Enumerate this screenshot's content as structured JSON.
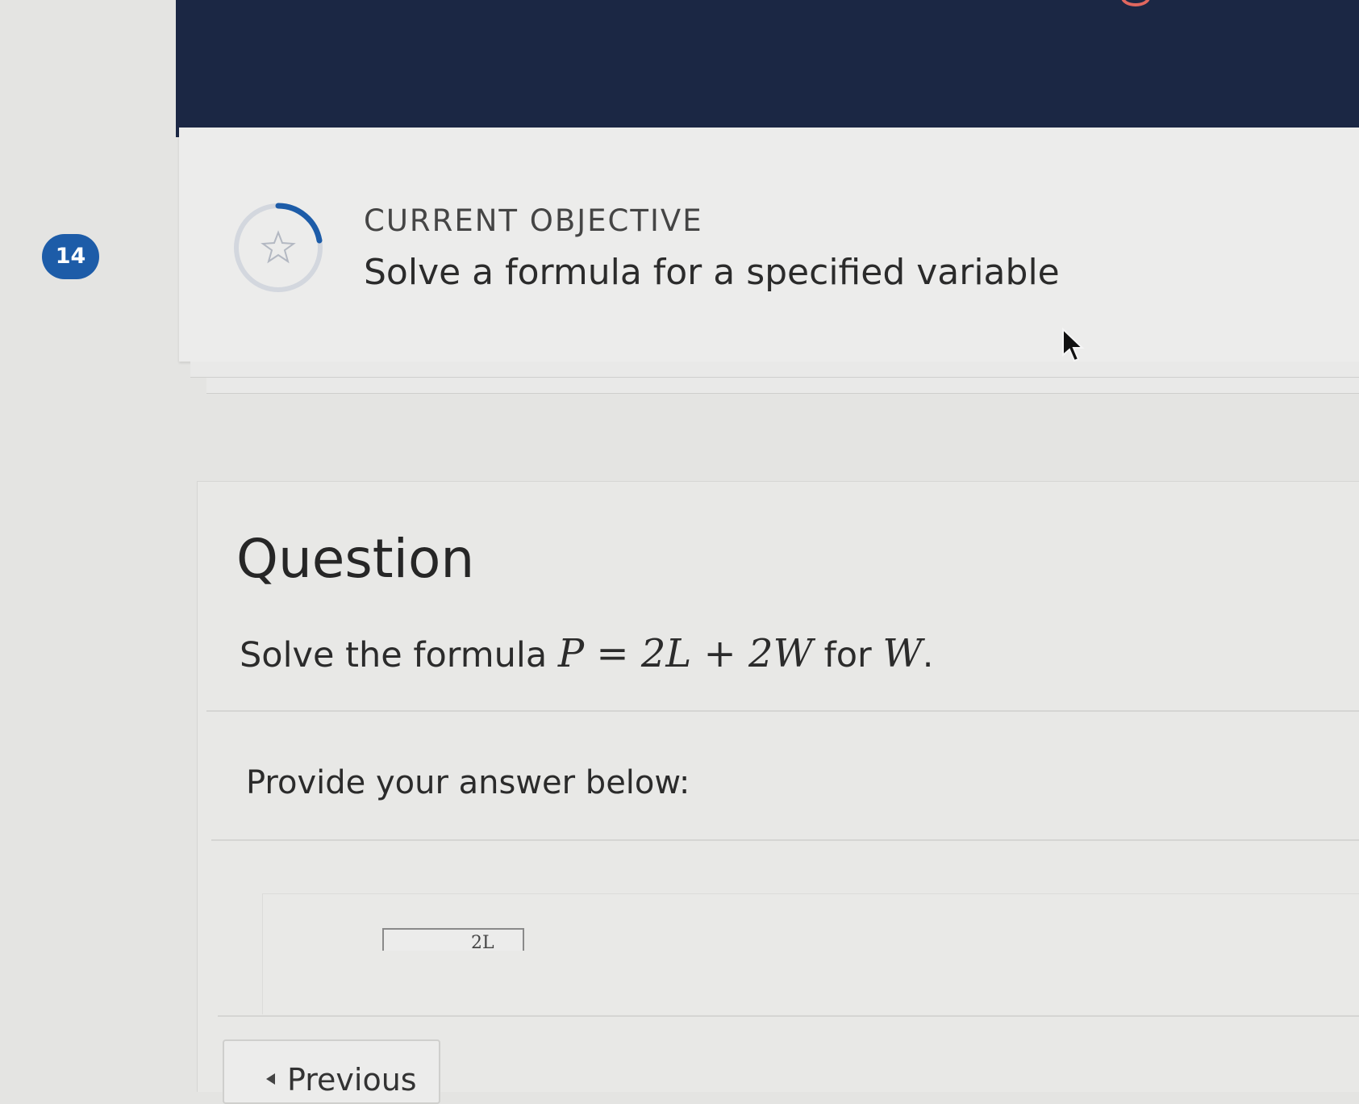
{
  "header": {
    "accent_color": "#1b2744"
  },
  "question_number": "14",
  "objective": {
    "label": "CURRENT OBJECTIVE",
    "title": "Solve a formula for a specified variable",
    "icon": "star-icon",
    "progress_ring_color": "#1d5ca8"
  },
  "question": {
    "heading": "Question",
    "text_prefix": "Solve the formula",
    "equation": "P = 2L + 2W",
    "text_middle": "for",
    "variable": "W",
    "text_suffix": ".",
    "answer_prompt": "Provide your answer below:",
    "input_fragment": "2L"
  },
  "navigation": {
    "previous_label": "Previous"
  },
  "colors": {
    "badge": "#1d5ca8",
    "background": "#e4e4e2"
  }
}
